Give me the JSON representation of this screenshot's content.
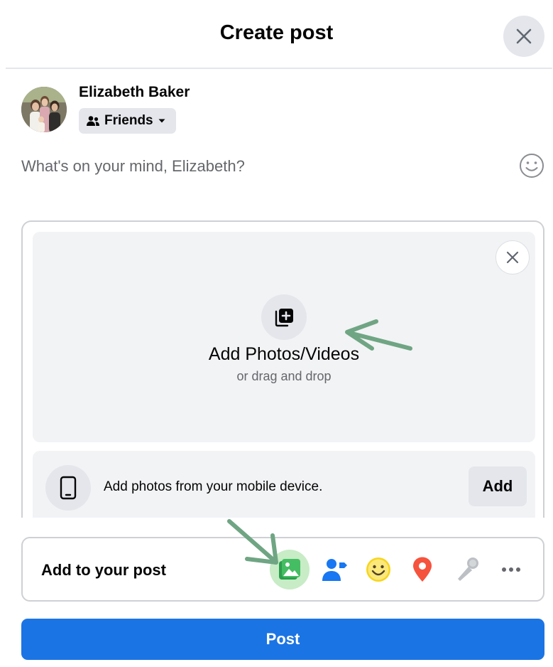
{
  "header": {
    "title": "Create post"
  },
  "user": {
    "name": "Elizabeth Baker",
    "audience": "Friends"
  },
  "composer": {
    "placeholder": "What's on your mind, Elizabeth?"
  },
  "media": {
    "title": "Add Photos/Videos",
    "subtitle": "or drag and drop",
    "mobile_text": "Add photos from your mobile device.",
    "add_label": "Add"
  },
  "add_to_post": {
    "label": "Add to your post",
    "options": [
      {
        "icon": "photo-video-icon",
        "color": "#45bd62",
        "highlighted": true
      },
      {
        "icon": "tag-people-icon",
        "color": "#1877f2"
      },
      {
        "icon": "feeling-activity-icon",
        "color": "#f7b928"
      },
      {
        "icon": "check-in-icon",
        "color": "#f5533d"
      },
      {
        "icon": "live-video-icon",
        "color": "#bcc0c4"
      },
      {
        "icon": "more-options-icon",
        "color": "#65676b"
      }
    ]
  },
  "post_button": {
    "label": "Post"
  },
  "annotations": {
    "arrow_color": "#6fa583"
  },
  "colors": {
    "primary": "#1b74e4",
    "secondary_bg": "#e4e6eb",
    "dropzone_bg": "#f2f3f5"
  }
}
